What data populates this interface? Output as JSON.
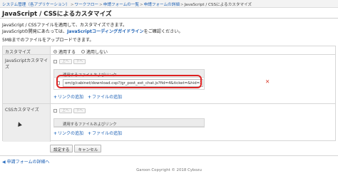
{
  "breadcrumb": {
    "items": [
      "システム管理（各アプリケーション）",
      "ワークフロー",
      "申請フォームの一覧",
      "申請フォームの詳細"
    ],
    "separator": ">",
    "current": "JavaScript / CSSによるカスタマイズ"
  },
  "page_title": "JavaScript / CSSによるカスタマイズ",
  "description": {
    "line1": "JavaScript / CSSファイルを適用して、カスタマイズできます。",
    "line2_prefix": "JavaScriptの開発にあたっては、",
    "line2_link": "JavaScriptコーディングガイドライン",
    "line2_suffix": "をご確認ください。",
    "line3": "5MBまでのファイルをアップロードできます。"
  },
  "customize": {
    "label": "カスタマイズ",
    "option_apply": "適用する",
    "option_not_apply": "適用しない",
    "selected": "適用する"
  },
  "js_section": {
    "label": "JavaScriptカスタマイズ",
    "up_button": "上へ",
    "down_button": "下へ",
    "file_header": "適用するファイルおよびリンク",
    "url_value": "om/g/cabinet/download.csp?/gr_post_ext_chat.js?fid=4&ticket=&hid=2&.js",
    "add_link": "リンクの追加",
    "add_file": "ファイルの追加"
  },
  "css_section": {
    "label": "CSSカスタマイズ",
    "up_button": "上へ",
    "down_button": "下へ",
    "file_header": "適用するファイルおよびリンク",
    "add_link": "リンクの追加",
    "add_file": "ファイルの追加"
  },
  "buttons": {
    "save": "設定する",
    "cancel": "キャンセル"
  },
  "back_link": "申請フォームの詳細へ",
  "footer": "Garoon Copyright © 2018 Cybozu",
  "colors": {
    "link": "#1a5fb4",
    "highlight": "#dd2222",
    "delete": "#d83a2a"
  }
}
